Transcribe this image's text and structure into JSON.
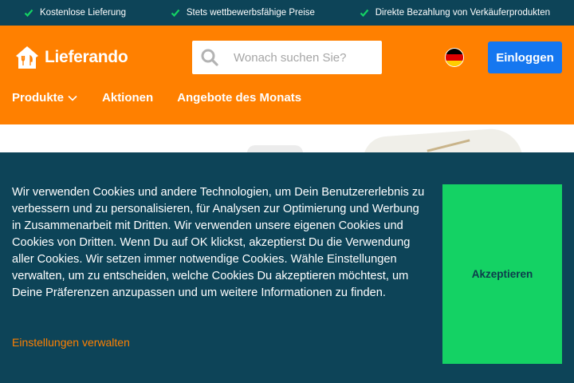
{
  "topbar": {
    "usps": [
      {
        "label": "Kostenlose Lieferung"
      },
      {
        "label": "Stets wettbewerbsfähige Preise"
      },
      {
        "label": "Direkte Bezahlung von Verkäuferprodukten"
      }
    ]
  },
  "header": {
    "logo_text": "Lieferando",
    "search": {
      "placeholder": "Wonach suchen Sie?",
      "value": ""
    },
    "language": "german-flag-icon",
    "login_label": "Einloggen"
  },
  "nav": {
    "items": [
      {
        "label": "Produkte"
      },
      {
        "label": "Aktionen"
      },
      {
        "label": "Angebote des Monats"
      }
    ]
  },
  "cookie": {
    "text": "Wir verwenden Cookies und andere Technologien, um Dein Benutzererlebnis zu verbessern und zu personalisieren, für Analysen zur Optimierung und Werbung in Zusammenarbeit mit Dritten. Wir verwenden unsere eigenen Cookies und Cookies von Dritten. Wenn Du auf OK klickst, akzeptierst Du die Verwendung aller Cookies. Wir setzen immer notwendige Cookies. Wähle Einstellungen verwalten, um zu entscheiden, welche Cookies Du akzeptieren möchtest, um Deine Präferenzen anzupassen und um weitere Informationen zu finden.",
    "settings_label": "Einstellungen verwalten",
    "accept_label": "Akzeptieren"
  },
  "colors": {
    "brand_orange": "#ff8000",
    "dark_teal": "#0d4458",
    "accept_green": "#14d264",
    "login_blue": "#1577f0"
  }
}
